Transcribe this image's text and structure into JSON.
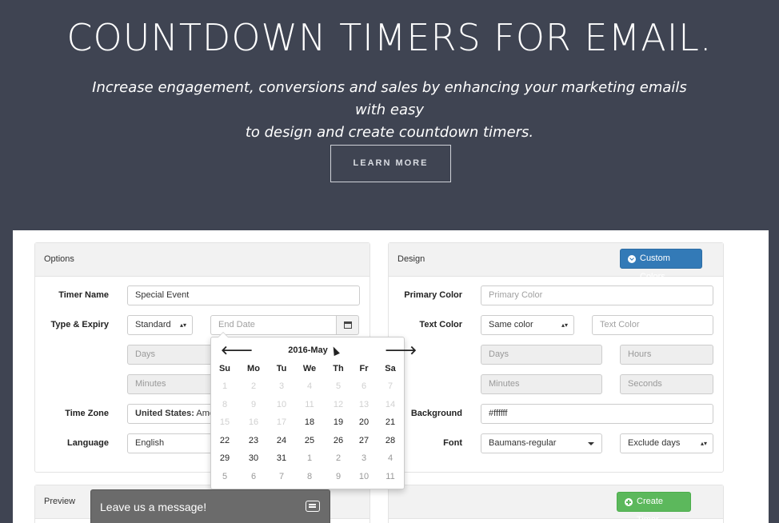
{
  "hero": {
    "title": "COUNTDOWN TIMERS FOR EMAIL.",
    "subtitle_line1": "Increase engagement, conversions and sales by enhancing your marketing emails with easy",
    "subtitle_line2": "to design and create countdown timers.",
    "cta_label": "LEARN MORE"
  },
  "options": {
    "heading": "Options",
    "timer_name_label": "Timer Name",
    "timer_name_value": "Special Event",
    "type_expiry_label": "Type & Expiry",
    "type_value": "Standard",
    "end_date_placeholder": "End Date",
    "days_placeholder": "Days",
    "minutes_placeholder": "Minutes",
    "time_zone_label": "Time Zone",
    "time_zone_country": "United States:",
    "time_zone_rest": " Amer",
    "language_label": "Language",
    "language_value": "English"
  },
  "datepicker": {
    "title": "2016-May",
    "prev": "🡐",
    "next": "🡒",
    "weekdays": [
      "Su",
      "Mo",
      "Tu",
      "We",
      "Th",
      "Fr",
      "Sa"
    ],
    "weeks": [
      [
        "1",
        "2",
        "3",
        "4",
        "5",
        "6",
        "7"
      ],
      [
        "8",
        "9",
        "10",
        "11",
        "12",
        "13",
        "14"
      ],
      [
        "15",
        "16",
        "17",
        "18",
        "19",
        "20",
        "21"
      ],
      [
        "22",
        "23",
        "24",
        "25",
        "26",
        "27",
        "28"
      ],
      [
        "29",
        "30",
        "31",
        "1",
        "2",
        "3",
        "4"
      ],
      [
        "5",
        "6",
        "7",
        "8",
        "9",
        "10",
        "11"
      ]
    ]
  },
  "design": {
    "heading": "Design",
    "custom_colors_label": "Custom Colors",
    "primary_color_label": "Primary Color",
    "primary_color_placeholder": "Primary Color",
    "text_color_label": "Text Color",
    "text_color_value": "Same color",
    "text_color_placeholder": "Text Color",
    "days_placeholder": "Days",
    "hours_placeholder": "Hours",
    "minutes_placeholder": "Minutes",
    "seconds_placeholder": "Seconds",
    "background_label": "Background",
    "background_value": "#ffffff",
    "font_label": "Font",
    "font_value": "Baumans-regular",
    "exclude_value": "Exclude days"
  },
  "preview": {
    "heading": "Preview",
    "create_label": "Create Timer"
  },
  "chat": {
    "label": "Leave us a message!"
  },
  "colors": {
    "hero_bg": "#3f4452",
    "primary_button": "#337ab7",
    "success_button": "#5cb85c",
    "chat_bg": "#6b6b6b"
  }
}
